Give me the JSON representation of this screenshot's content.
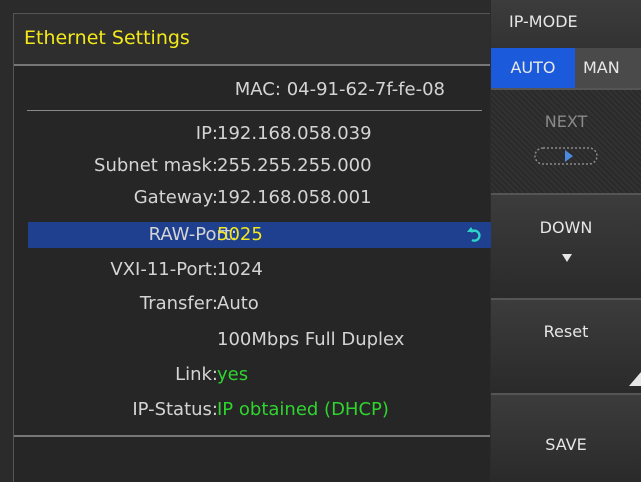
{
  "header": {
    "title": "Ethernet Settings"
  },
  "mac": {
    "label": "MAC:",
    "value": "04-91-62-7f-fe-08"
  },
  "fields": [
    {
      "label": "IP:",
      "value": "192.168.058.039"
    },
    {
      "label": "Subnet mask:",
      "value": "255.255.255.000"
    },
    {
      "label": "Gateway:",
      "value": "192.168.058.001"
    },
    {
      "label": "RAW-Port:",
      "value": "5025"
    },
    {
      "label": "VXI-11-Port:",
      "value": "1024"
    },
    {
      "label": "Transfer:",
      "value": "Auto"
    },
    {
      "label": "",
      "value": "100Mbps Full Duplex"
    },
    {
      "label": "Link:",
      "value": "yes"
    },
    {
      "label": "IP-Status:",
      "value": "IP obtained (DHCP)"
    }
  ],
  "softkeys": {
    "ip_mode": {
      "title": "IP-MODE",
      "options": [
        "AUTO",
        "MAN"
      ],
      "selected": "AUTO"
    },
    "next": {
      "label": "NEXT",
      "enabled": false
    },
    "down": {
      "label": "DOWN"
    },
    "reset": {
      "label": "Reset"
    },
    "save": {
      "label": "SAVE"
    }
  },
  "icons": {
    "edit": "rotate-arrow-icon",
    "down": "triangle-down-icon",
    "next": "arrow-right-icon"
  },
  "colors": {
    "accent_yellow": "#f2e81a",
    "status_green": "#2fd42f",
    "selection_blue": "#1f3f8f",
    "mode_active": "#1c5adc"
  }
}
